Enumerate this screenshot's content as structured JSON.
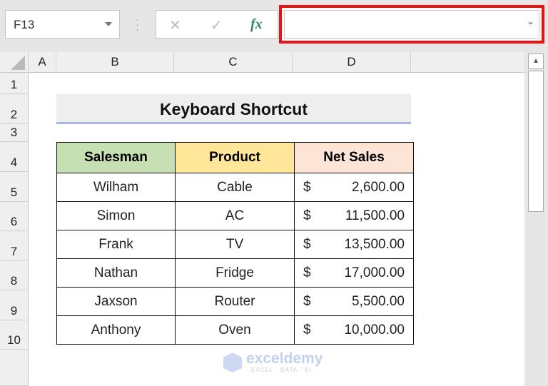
{
  "name_box": {
    "value": "F13"
  },
  "formula_bar": {
    "cancel_icon": "✕",
    "enter_icon": "✓",
    "fx_label": "fx",
    "value": ""
  },
  "columns": [
    "A",
    "B",
    "C",
    "D"
  ],
  "rows": [
    "1",
    "2",
    "3",
    "4",
    "5",
    "6",
    "7",
    "8",
    "9",
    "10"
  ],
  "sheet": {
    "title": "Keyboard Shortcut",
    "headers": [
      "Salesman",
      "Product",
      "Net Sales"
    ],
    "header_colors": [
      "#c6e0b4",
      "#ffe699",
      "#fce4d6"
    ],
    "currency": "$",
    "rows": [
      [
        "Wilham",
        "Cable",
        "2,600.00"
      ],
      [
        "Simon",
        "AC",
        "11,500.00"
      ],
      [
        "Frank",
        "TV",
        "13,500.00"
      ],
      [
        "Nathan",
        "Fridge",
        "17,000.00"
      ],
      [
        "Jaxson",
        "Router",
        "5,500.00"
      ],
      [
        "Anthony",
        "Oven",
        "10,000.00"
      ]
    ]
  },
  "watermark": {
    "brand": "exceldemy",
    "tagline": "EXCEL · DATA · BI"
  },
  "highlight_color": "#ee1111"
}
